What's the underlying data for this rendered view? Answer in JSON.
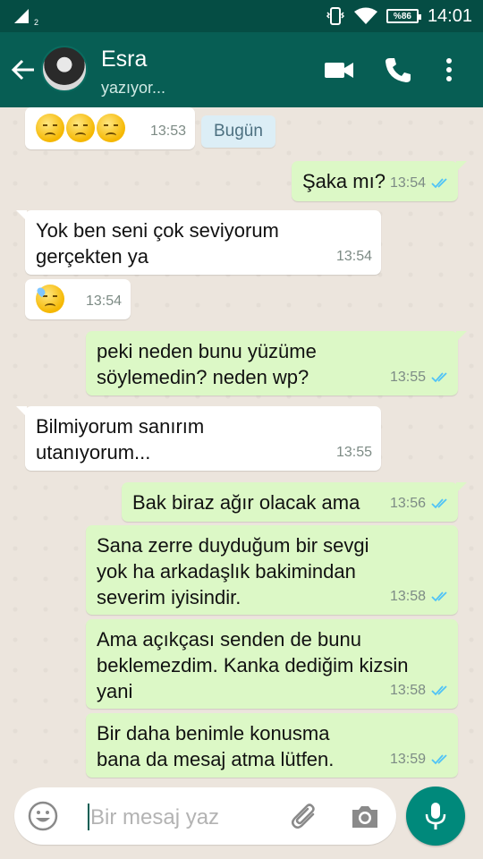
{
  "status_bar": {
    "battery": "%86",
    "time": "14:01",
    "sim_index": "2"
  },
  "contact": {
    "name": "Esra",
    "status": "yazıyor..."
  },
  "date_chip": "Bugün",
  "messages": [
    {
      "dir": "in",
      "text": "",
      "emoji": [
        "disappointed-face",
        "disappointed-face",
        "disappointed-face"
      ],
      "time": "13:53"
    },
    {
      "dir": "out",
      "text": "Şaka mı?",
      "time": "13:54",
      "read": true
    },
    {
      "dir": "in",
      "text": "Yok ben seni çok seviyorum gerçekten ya",
      "time": "13:54"
    },
    {
      "dir": "in",
      "text": "",
      "emoji": [
        "downcast-face-with-sweat"
      ],
      "time": "13:54"
    },
    {
      "dir": "out",
      "text": "peki neden bunu yüzüme söylemedin? neden wp?",
      "time": "13:55",
      "read": true
    },
    {
      "dir": "in",
      "text": "Bilmiyorum sanırım utanıyorum...",
      "time": "13:55"
    },
    {
      "dir": "out",
      "text": "Bak biraz ağır olacak ama",
      "time": "13:56",
      "read": true
    },
    {
      "dir": "out",
      "text": "Sana zerre duyduğum bir sevgi yok ha arkadaşlık bakimindan severim iyisindir.",
      "time": "13:58",
      "read": true
    },
    {
      "dir": "out",
      "text": "Ama açıkçası senden de bunu beklemezdim. Kanka dediğim kizsin yani",
      "time": "13:58",
      "read": true
    },
    {
      "dir": "out",
      "text": "Bir daha benimle konusma bana da mesaj atma lütfen.",
      "time": "13:59",
      "read": true
    }
  ],
  "composer": {
    "placeholder": "Bir mesaj yaz"
  },
  "icons": [
    "back-arrow-icon",
    "video-call-icon",
    "phone-call-icon",
    "more-vert-icon",
    "emoji-icon",
    "attach-icon",
    "camera-icon",
    "mic-icon",
    "double-check-icon"
  ],
  "colors": {
    "header": "#075e54",
    "status_bar": "#054d44",
    "outgoing": "#dcf8c6",
    "incoming": "#ffffff",
    "read_check": "#4fc3f7",
    "mic_button": "#00897b"
  }
}
